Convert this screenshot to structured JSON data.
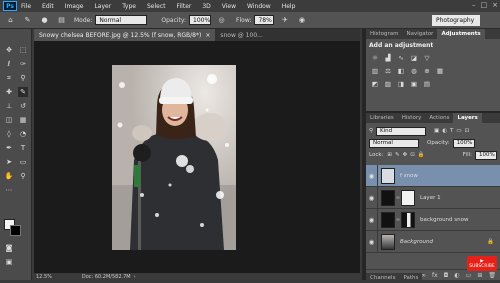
{
  "menubar": {
    "logo": "Ps",
    "items": [
      "File",
      "Edit",
      "Image",
      "Layer",
      "Type",
      "Select",
      "Filter",
      "3D",
      "View",
      "Window",
      "Help"
    ]
  },
  "options": {
    "mode_label": "Mode:",
    "mode_value": "Normal",
    "opacity_label": "Opacity:",
    "opacity_value": "100%",
    "flow_label": "Flow:",
    "flow_value": "78%",
    "workspace": "Photography"
  },
  "doc_tabs": [
    {
      "label": "Snowy chelsea BEFORE.jpg @ 12.5% (f snow, RGB/8*)",
      "close": "×",
      "active": true
    },
    {
      "label": "snow @ 100...",
      "close": "",
      "active": false
    }
  ],
  "status": {
    "zoom": "12.5%",
    "doc": "Doc: 60.2M/582.7M"
  },
  "panels": {
    "top_tabs": [
      "Histogram",
      "Navigator",
      "Adjustments"
    ],
    "adj_title": "Add an adjustment",
    "layer_tabs": [
      "Libraries",
      "History",
      "Actions",
      "Layers"
    ],
    "kind_label": "Kind",
    "blend_mode": "Normal",
    "opacity_label": "Opacity:",
    "opacity_value": "100%",
    "lock_label": "Lock:",
    "fill_label": "Fill:",
    "fill_value": "100%",
    "layers": [
      {
        "name": "f snow",
        "active": true
      },
      {
        "name": "Layer 1",
        "active": false
      },
      {
        "name": "background snow",
        "active": false
      },
      {
        "name": "Background",
        "active": false
      }
    ],
    "bottom_tabs": [
      "Channels",
      "Paths"
    ]
  },
  "youtube": {
    "label": "SUBSCRIBE"
  }
}
